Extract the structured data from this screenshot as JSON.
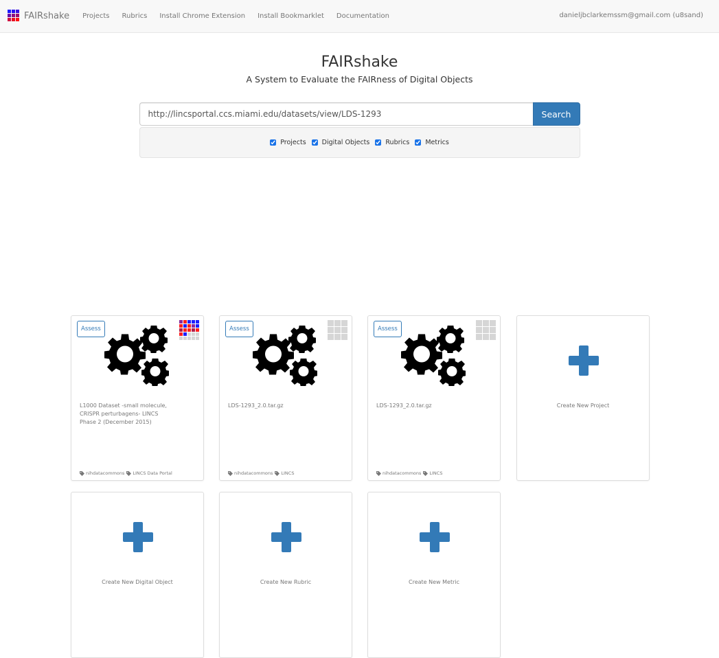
{
  "navbar": {
    "brand": "FAIRshake",
    "links": [
      "Projects",
      "Rubrics",
      "Install Chrome Extension",
      "Install Bookmarklet",
      "Documentation"
    ],
    "user": "danieljbclarkemssm@gmail.com (u8sand)",
    "logo_colors": [
      "#1a1aff",
      "#2a10ee",
      "#3a10dd",
      "#6a10a8",
      "#8a1080",
      "#9a1070",
      "#d01040",
      "#e81020",
      "#ff1010"
    ]
  },
  "hero": {
    "title": "FAIRshake",
    "subtitle": "A System to Evaluate the FAIRness of Digital Objects"
  },
  "search": {
    "value": "http://lincsportal.ccs.miami.edu/datasets/view/LDS-1293",
    "button": "Search",
    "filters": [
      {
        "label": "Projects",
        "checked": true
      },
      {
        "label": "Digital Objects",
        "checked": true
      },
      {
        "label": "Rubrics",
        "checked": true
      },
      {
        "label": "Metrics",
        "checked": true
      }
    ]
  },
  "colors": {
    "accent": "#337ab7",
    "insignia_purple": "#8b2a9b",
    "insignia_red": "#ff1f1f",
    "insignia_blue": "#1f1fff",
    "insignia_crimson": "#b0204a",
    "insignia_empty": "#d6d6d6"
  },
  "results": [
    {
      "assess": "Assess",
      "title": "L1000 Dataset -small molecule, CRISPR perturbagens- LINCS Phase 2 (December 2015)",
      "tags": [
        "nihdatacommons",
        "LINCS Data Portal"
      ],
      "insignia": [
        "purple",
        "red",
        "blue",
        "blue",
        "blue",
        "red",
        "blue",
        "red",
        "purple",
        "blue",
        "crimson",
        "red",
        "red",
        "crimson",
        "red",
        "red",
        "blue",
        "empty",
        "empty",
        "empty",
        "empty",
        "empty",
        "empty",
        "empty",
        "empty"
      ]
    },
    {
      "assess": "Assess",
      "title": "LDS-1293_2.0.tar.gz",
      "tags": [
        "nihdatacommons",
        "LINCS"
      ],
      "insignia": null
    },
    {
      "assess": "Assess",
      "title": "LDS-1293_2.0.tar.gz",
      "tags": [
        "nihdatacommons",
        "LINCS"
      ],
      "insignia": null
    }
  ],
  "create_cards": [
    {
      "label": "Create New Project"
    },
    {
      "label": "Create New Digital Object"
    },
    {
      "label": "Create New Rubric"
    },
    {
      "label": "Create New Metric"
    }
  ]
}
